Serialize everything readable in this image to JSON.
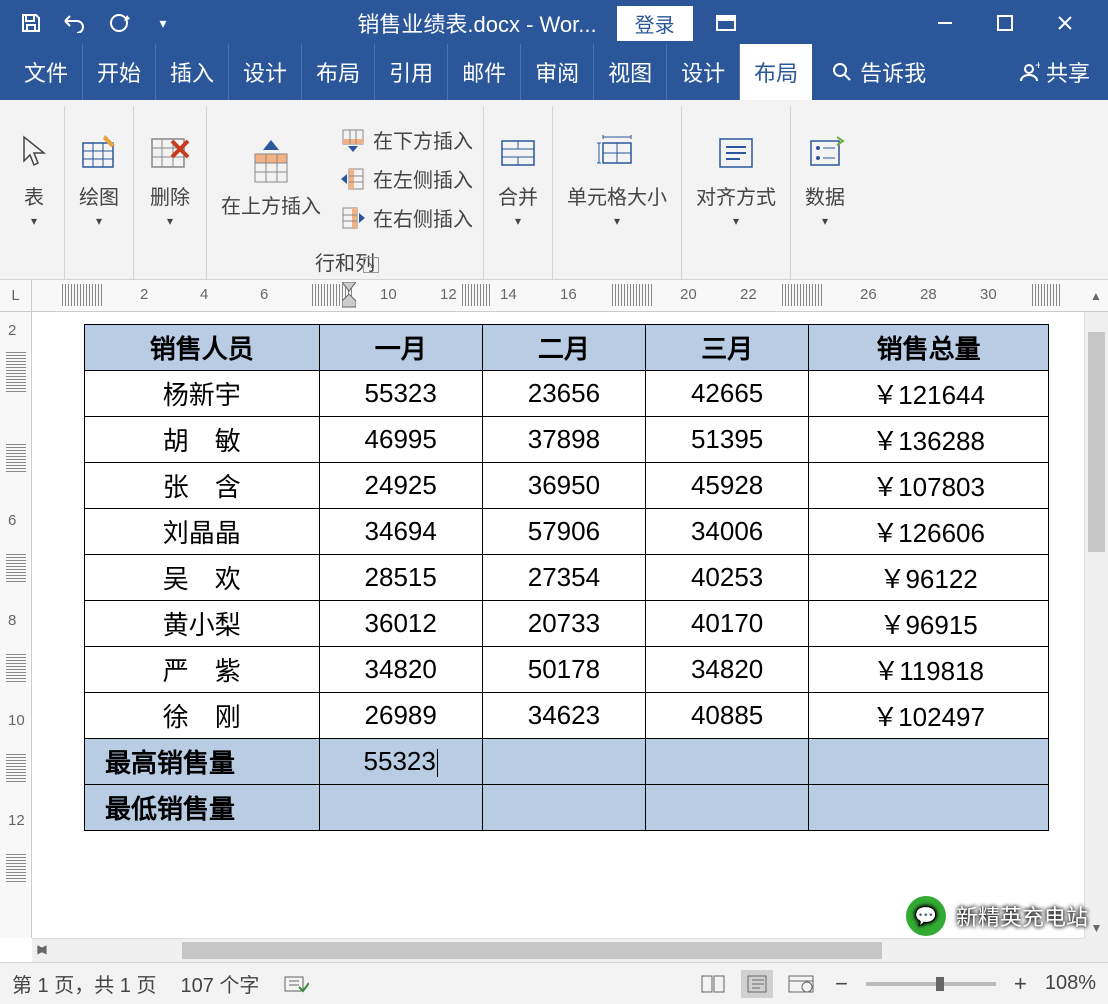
{
  "titlebar": {
    "doc_title": "销售业绩表.docx - Wor...",
    "login": "登录"
  },
  "menus": {
    "file": "文件",
    "home": "开始",
    "insert": "插入",
    "design1": "设计",
    "layout1": "布局",
    "references": "引用",
    "mailings": "邮件",
    "review": "审阅",
    "view": "视图",
    "design2": "设计",
    "layout2": "布局",
    "tellme": "告诉我",
    "share": "共享"
  },
  "ribbon": {
    "table": "表",
    "draw": "绘图",
    "delete": "删除",
    "insert_above": "在上方插入",
    "insert_below": "在下方插入",
    "insert_left": "在左侧插入",
    "insert_right": "在右侧插入",
    "rows_cols": "行和列",
    "merge": "合并",
    "cell_size": "单元格大小",
    "alignment": "对齐方式",
    "data": "数据"
  },
  "ruler_h": [
    "2",
    "4",
    "6",
    "10",
    "12",
    "14",
    "16",
    "20",
    "22",
    "26",
    "28",
    "30"
  ],
  "ruler_v": [
    "2",
    "6",
    "8",
    "10",
    "12"
  ],
  "table": {
    "headers": [
      "销售人员",
      "一月",
      "二月",
      "三月",
      "销售总量"
    ],
    "rows": [
      {
        "name": "杨新宇",
        "m1": "55323",
        "m2": "23656",
        "m3": "42665",
        "total": "￥121644"
      },
      {
        "name": "胡　敏",
        "m1": "46995",
        "m2": "37898",
        "m3": "51395",
        "total": "￥136288"
      },
      {
        "name": "张　含",
        "m1": "24925",
        "m2": "36950",
        "m3": "45928",
        "total": "￥107803"
      },
      {
        "name": "刘晶晶",
        "m1": "34694",
        "m2": "57906",
        "m3": "34006",
        "total": "￥126606"
      },
      {
        "name": "吴　欢",
        "m1": "28515",
        "m2": "27354",
        "m3": "40253",
        "total": "￥96122"
      },
      {
        "name": "黄小梨",
        "m1": "36012",
        "m2": "20733",
        "m3": "40170",
        "total": "￥96915"
      },
      {
        "name": "严　紫",
        "m1": "34820",
        "m2": "50178",
        "m3": "34820",
        "total": "￥119818"
      },
      {
        "name": "徐　刚",
        "m1": "26989",
        "m2": "34623",
        "m3": "40885",
        "total": "￥102497"
      }
    ],
    "max_label": "最高销售量",
    "max_val": "55323",
    "min_label": "最低销售量"
  },
  "status": {
    "page": "第 1 页，共 1 页",
    "words": "107 个字",
    "zoom": "108%"
  },
  "watermark": "新精英充电站"
}
